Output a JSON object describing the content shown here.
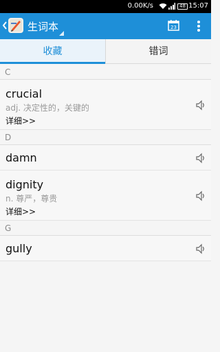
{
  "status_bar": {
    "network_rate": "0.00K/s",
    "battery_level": "48",
    "time": "15:07"
  },
  "action_bar": {
    "title": "生词本",
    "calendar_day": "23",
    "accent": "#1e8fd8"
  },
  "tabs": [
    {
      "label": "收藏",
      "active": true
    },
    {
      "label": "错词",
      "active": false
    }
  ],
  "sections": [
    {
      "letter": "C",
      "words": [
        {
          "word": "crucial",
          "definition": "adj. 决定性的，关键的",
          "detail": "详细>>"
        }
      ]
    },
    {
      "letter": "D",
      "words": [
        {
          "word": "damn"
        },
        {
          "word": "dignity",
          "definition": "n. 尊严，尊贵",
          "detail": "详细>>"
        }
      ]
    },
    {
      "letter": "G",
      "words": [
        {
          "word": "gully"
        }
      ]
    }
  ]
}
